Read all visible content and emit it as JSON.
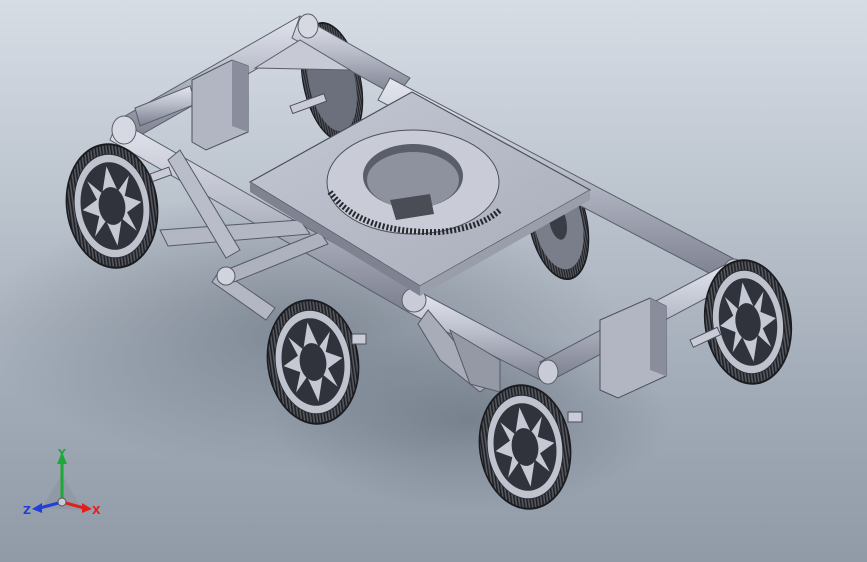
{
  "viewport": {
    "background_top": "#d7dde5",
    "background_bottom": "#909ba7"
  },
  "model": {
    "part_color": "#b8bcc8",
    "shade_color": "#7d8190",
    "dark_color": "#3e414b"
  },
  "triad": {
    "x_label": "X",
    "y_label": "Y",
    "z_label": "Z",
    "x_color": "#e0201c",
    "y_color": "#1fa83a",
    "z_color": "#1f3fd6"
  }
}
